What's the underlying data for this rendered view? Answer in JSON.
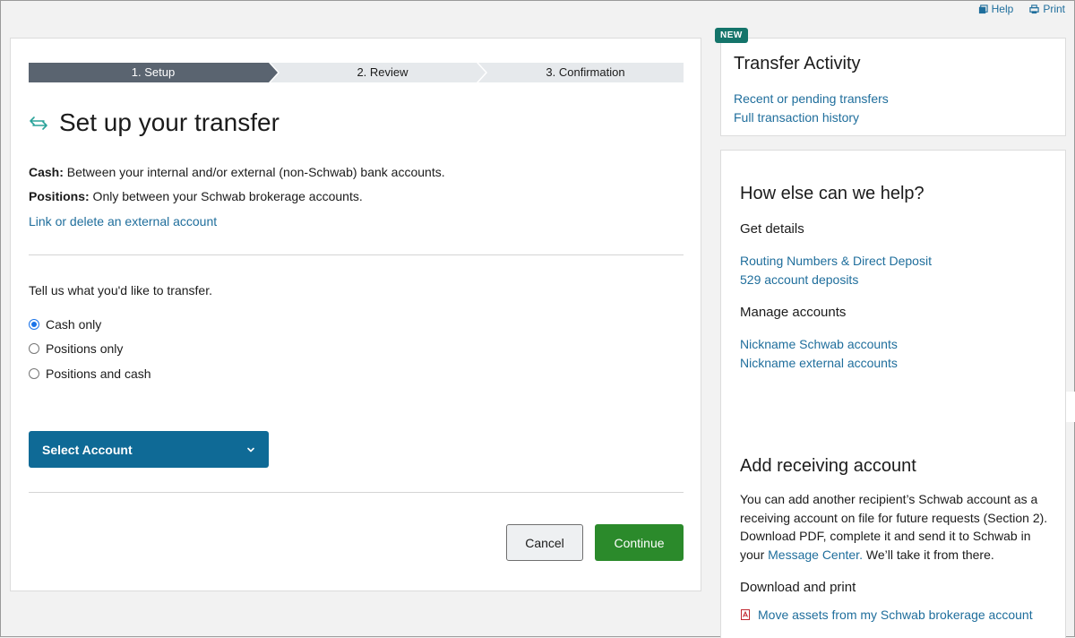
{
  "utility": {
    "help_label": "Help",
    "print_label": "Print"
  },
  "stepper": {
    "steps": [
      "1. Setup",
      "2. Review",
      "3. Confirmation"
    ],
    "active_step": 1
  },
  "main": {
    "title": "Set up your transfer",
    "cash_label": "Cash:",
    "cash_text": " Between your internal and/or external (non-Schwab) bank accounts.",
    "positions_label": "Positions:",
    "positions_text": " Only between your Schwab brokerage accounts.",
    "link_external": "Link or delete an external account",
    "question": "Tell us what you'd like to transfer.",
    "options": [
      {
        "label": "Cash only",
        "checked": true
      },
      {
        "label": "Positions only",
        "checked": false
      },
      {
        "label": "Positions and cash",
        "checked": false
      }
    ],
    "select_account_label": "Select Account",
    "cancel_label": "Cancel",
    "continue_label": "Continue"
  },
  "activity": {
    "badge": "NEW",
    "title": "Transfer Activity",
    "links": [
      "Recent or pending transfers",
      "Full transaction history"
    ]
  },
  "help": {
    "title": "How else can we help?",
    "get_details": "Get details",
    "details_links": [
      "Routing Numbers & Direct Deposit",
      "529 account deposits"
    ],
    "manage_accounts": "Manage accounts",
    "manage_links": [
      "Nickname Schwab accounts",
      "Nickname external accounts"
    ],
    "receive_title": "Add receiving account",
    "receive_text_1": "You can add another recipient’s Schwab account as a receiving account on file for future requests (Section 2). Download PDF, complete it and send it to Schwab in your ",
    "receive_link": "Message Center.",
    "receive_text_2": " We’ll take it from there.",
    "download_title": "Download and print",
    "pdf_link": "Move assets from my Schwab brokerage account"
  },
  "colors": {
    "primary_blue": "#0f6a96",
    "link_blue": "#1f6e9c",
    "continue_green": "#2b8a2b",
    "badge_teal": "#14746a",
    "active_step": "#5a6470"
  }
}
